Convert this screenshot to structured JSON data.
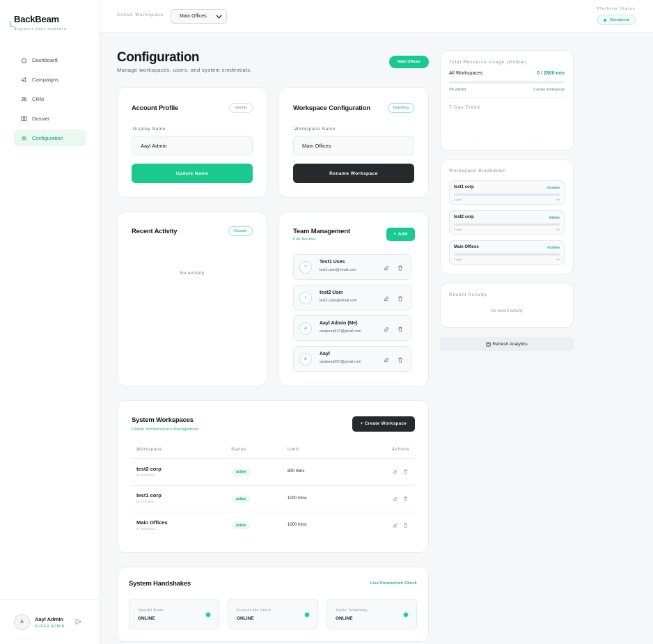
{
  "app": {
    "name": "BackBeam",
    "tagline": "Support that matters"
  },
  "sidebar": {
    "items": [
      {
        "label": "Dashboard",
        "icon": "home-icon"
      },
      {
        "label": "Campaigns",
        "icon": "megaphone-icon"
      },
      {
        "label": "CRM",
        "icon": "people-icon"
      },
      {
        "label": "Dossier",
        "icon": "book-icon"
      },
      {
        "label": "Configuration",
        "icon": "gear-icon",
        "active": true
      }
    ],
    "user": {
      "initial": "A",
      "name": "Aayl Admin",
      "role": "SUPER ADMIN"
    }
  },
  "topbar": {
    "workspace_label": "Active Workspace",
    "workspace_value": "Main Offices",
    "platform_label": "Platform Status",
    "platform_status": "Operational"
  },
  "header": {
    "title": "Configuration",
    "subtitle": "Manage workspaces, users, and system credentials.",
    "workspace_pill": "Main Offices"
  },
  "account": {
    "title": "Account Profile",
    "tag": "Identity",
    "field_label": "Display Name",
    "value": "Aayl Admin",
    "button": "Update Name"
  },
  "workspace_config": {
    "title": "Workspace Configuration",
    "tag": "Branding",
    "field_label": "Workspace Name",
    "value": "Main Offices",
    "button": "Rename Workspace"
  },
  "recent_activity": {
    "title": "Recent Activity",
    "tag": "Dossier",
    "empty": "No activity"
  },
  "team": {
    "title": "Team Management",
    "subtitle": "Full Access",
    "add_button": "+ Add",
    "members": [
      {
        "initial": "T",
        "name": "Test1 Uses",
        "email": "test1.user@email.com"
      },
      {
        "initial": "t",
        "name": "test2 User",
        "email": "test2.User@email.com"
      },
      {
        "initial": "A",
        "name": "Aayl Admin (Me)",
        "email": "aarijseeq517@gmail.com"
      },
      {
        "initial": "A",
        "name": "Aayl",
        "email": "aarijseeq007@gmail.com"
      }
    ]
  },
  "system_workspaces": {
    "title": "System Workspaces",
    "subtitle": "Global Infrastructure Management",
    "create_button": "+ Create Workspace",
    "columns": [
      "Workspace",
      "Status",
      "Limit",
      "Actions"
    ],
    "rows": [
      {
        "name": "test2 corp",
        "id": "ID: f04d07e8...",
        "status": "active",
        "limit": "800 mins"
      },
      {
        "name": "test1 corp",
        "id": "ID: f3750fe8...",
        "status": "active",
        "limit": "1000 mins"
      },
      {
        "name": "Main Offices",
        "id": "ID: 96e8e0a4...",
        "status": "active",
        "limit": "1000 mins"
      }
    ]
  },
  "handshakes": {
    "title": "System Handshakes",
    "link": "Live Connection Check",
    "items": [
      {
        "name": "OpenAI Brain",
        "status": "ONLINE"
      },
      {
        "name": "ElevenLabs Voice",
        "status": "ONLINE"
      },
      {
        "name": "Twilio Telephony",
        "status": "ONLINE"
      }
    ]
  },
  "usage": {
    "title": "Total Resource Usage (Global)",
    "label": "All Workspaces",
    "value": "0 / 2800 min",
    "utilized": "0% utilized",
    "active": "3 active workspaces",
    "utilized_fraction": 0,
    "trend_label": "7-Day Trend",
    "trend_x1": "-",
    "trend_x2": "-"
  },
  "breakdown": {
    "title": "Workspace Breakdown",
    "items": [
      {
        "name": "test1 corp",
        "value": "0/1000m",
        "left": "0 calls",
        "right": "0%",
        "fraction": 0
      },
      {
        "name": "test2 corp",
        "value": "0/800m",
        "left": "0 calls",
        "right": "0%",
        "fraction": 0
      },
      {
        "name": "Main Offices",
        "value": "0/1000m",
        "left": "0 calls",
        "right": "0%",
        "fraction": 0
      }
    ]
  },
  "right_activity": {
    "title": "Recent Activity",
    "empty": "No recent activity"
  },
  "refresh_label": "Refresh Analytics",
  "colors": {
    "accent": "#19c98e",
    "dark": "#27292d",
    "background": "#f6f7f8"
  }
}
